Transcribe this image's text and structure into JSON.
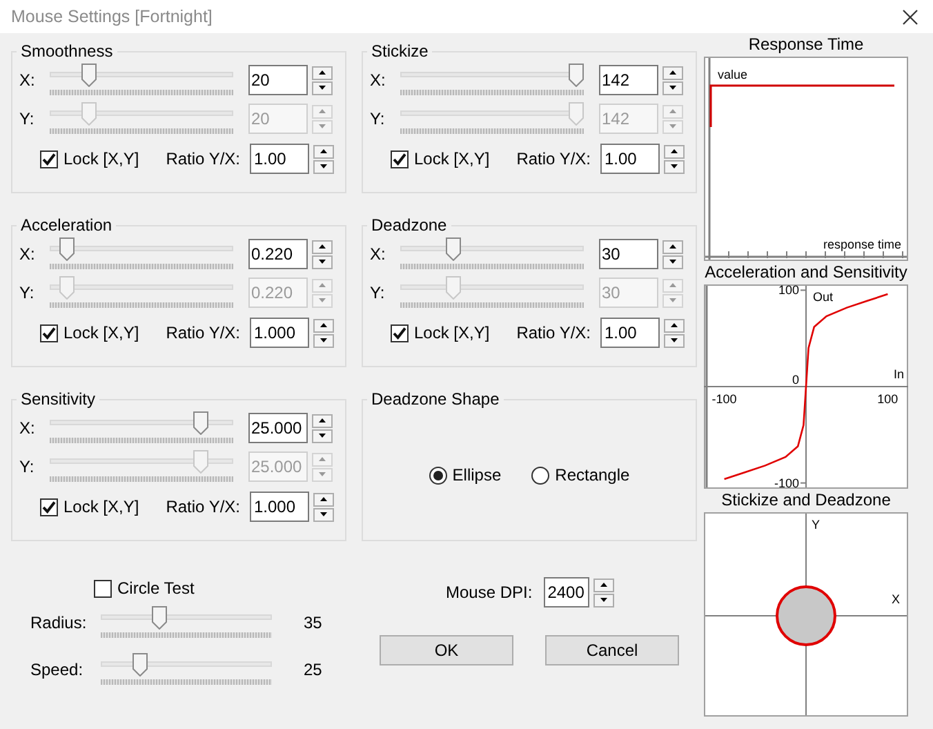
{
  "window": {
    "title": "Mouse Settings [Fortnight]"
  },
  "groups": [
    {
      "title": "Smoothness",
      "rows": [
        {
          "label": "X:",
          "level": 0.19,
          "value": "20",
          "disabled": false
        },
        {
          "label": "Y:",
          "level": 0.19,
          "value": "20",
          "disabled": true
        }
      ],
      "lock": {
        "label": "Lock [X,Y]",
        "checked": true
      },
      "ratio": {
        "label": "Ratio Y/X:",
        "value": "1.00"
      }
    },
    {
      "title": "Stickize",
      "rows": [
        {
          "label": "X:",
          "level": 1.0,
          "value": "142",
          "disabled": false
        },
        {
          "label": "Y:",
          "level": 1.0,
          "value": "142",
          "disabled": true
        }
      ],
      "lock": {
        "label": "Lock [X,Y]",
        "checked": true
      },
      "ratio": {
        "label": "Ratio Y/X:",
        "value": "1.00"
      }
    },
    {
      "title": "Acceleration",
      "rows": [
        {
          "label": "X:",
          "level": 0.06,
          "value": "0.220",
          "disabled": false
        },
        {
          "label": "Y:",
          "level": 0.06,
          "value": "0.220",
          "disabled": true
        }
      ],
      "lock": {
        "label": "Lock [X,Y]",
        "checked": true
      },
      "ratio": {
        "label": "Ratio Y/X:",
        "value": "1.000"
      }
    },
    {
      "title": "Deadzone",
      "rows": [
        {
          "label": "X:",
          "level": 0.27,
          "value": "30",
          "disabled": false
        },
        {
          "label": "Y:",
          "level": 0.27,
          "value": "30",
          "disabled": true
        }
      ],
      "lock": {
        "label": "Lock [X,Y]",
        "checked": true
      },
      "ratio": {
        "label": "Ratio Y/X:",
        "value": "1.00"
      }
    },
    {
      "title": "Sensitivity",
      "rows": [
        {
          "label": "X:",
          "level": 0.85,
          "value": "25.000",
          "disabled": false
        },
        {
          "label": "Y:",
          "level": 0.85,
          "value": "25.000",
          "disabled": true
        }
      ],
      "lock": {
        "label": "Lock [X,Y]",
        "checked": true
      },
      "ratio": {
        "label": "Ratio Y/X:",
        "value": "1.000"
      }
    }
  ],
  "deadzone_shape": {
    "title": "Deadzone Shape",
    "options": [
      {
        "label": "Ellipse",
        "selected": true
      },
      {
        "label": "Rectangle",
        "selected": false
      }
    ]
  },
  "circle_test": {
    "label": "Circle Test",
    "checked": false,
    "sliders": [
      {
        "label": "Radius:",
        "level": 0.33,
        "reading": "35"
      },
      {
        "label": "Speed:",
        "level": 0.2,
        "reading": "25"
      }
    ]
  },
  "mouse_dpi": {
    "label": "Mouse DPI:",
    "value": "2400"
  },
  "buttons": [
    "OK",
    "Cancel"
  ],
  "charts": [
    {
      "title": "Response Time",
      "kind": "response",
      "labels": [
        "value",
        "response time"
      ]
    },
    {
      "title": "Acceleration and Sensitivity",
      "kind": "curve",
      "chart_data": {
        "type": "line",
        "xlabel": "In",
        "ylabel": "Out",
        "x": [
          -100,
          -75,
          -50,
          -25,
          -10,
          -3,
          0,
          3,
          10,
          25,
          50,
          75,
          100
        ],
        "series": [
          {
            "color": "#e00000",
            "values": [
              -96,
              -89,
              -82,
              -73,
              -62,
              -40,
              0,
              40,
              62,
              73,
              82,
              89,
              96
            ]
          }
        ],
        "xlim": [
          -125,
          125
        ],
        "ylim": [
          -106,
          106
        ],
        "xticks": [
          -100,
          100
        ],
        "yticks": [
          -100,
          0,
          100
        ]
      }
    },
    {
      "title": "Stickize and Deadzone",
      "kind": "shape",
      "labels": [
        "Y",
        "X"
      ]
    }
  ]
}
